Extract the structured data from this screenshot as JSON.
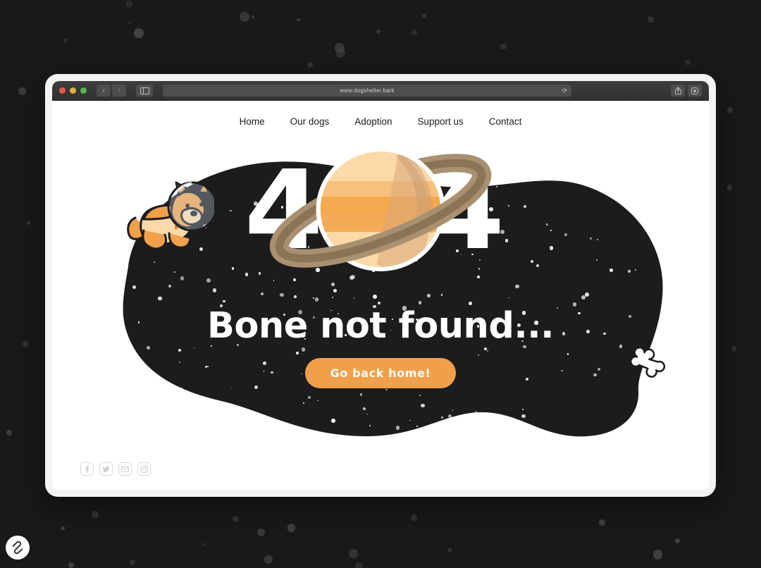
{
  "browser": {
    "url": "www.dogshelter.bark",
    "traffic_lights": [
      "close-red",
      "minimize-yellow",
      "maximize-green"
    ],
    "back_icon": "‹",
    "forward_icon": "›",
    "sidebar_icon": "sidebar-toggle-icon",
    "reload_icon": "⟳",
    "share_icon": "share-icon",
    "newtab_icon": "new-tab-icon"
  },
  "site": {
    "nav": [
      {
        "label": "Home"
      },
      {
        "label": "Our dogs"
      },
      {
        "label": "Adoption"
      },
      {
        "label": "Support us"
      },
      {
        "label": "Contact"
      }
    ],
    "error": {
      "code_left": "4",
      "code_right": "4",
      "code_full": "404",
      "tagline": "Bone not found...",
      "cta_label": "Go back home!"
    },
    "illustrations": {
      "dog": "astronaut-dog-illustration",
      "planet": "saturn-planet-illustration",
      "bone": "bone-illustration",
      "blob": "space-blob-shape"
    },
    "socials": [
      {
        "name": "facebook",
        "glyph": "f"
      },
      {
        "name": "twitter",
        "glyph": "t"
      },
      {
        "name": "email",
        "glyph": "m"
      },
      {
        "name": "instagram",
        "glyph": "i"
      }
    ]
  },
  "branding": {
    "logo": "squarespace-style-logo"
  },
  "colors": {
    "page_background": "#191919",
    "blob": "#1c1c1e",
    "accent_orange": "#f0a04b",
    "planet_light": "#fbd9a8",
    "planet_mid": "#f5a94e",
    "ring_brown": "#8b7355",
    "ring_light_brown": "#a89070",
    "text_dark": "#1c1c1e",
    "social_border": "#d8d8d8"
  }
}
